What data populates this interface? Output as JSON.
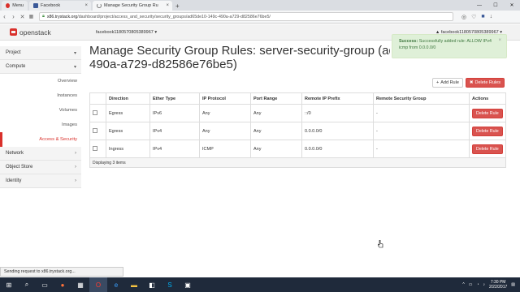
{
  "browser": {
    "tabs": [
      {
        "label": "Menu",
        "icon": "opera-icon",
        "active": false
      },
      {
        "label": "Facebook",
        "icon": "facebook-icon",
        "active": false
      },
      {
        "label": "Manage Security Group Ru",
        "icon": "loading-icon",
        "active": true
      }
    ],
    "new_tab": "+",
    "url_host": "x86.trystack.org",
    "url_path": "/dashboard/project/access_and_security/security_groups/ad65de10-149c-490a-a729-d82586e76be5/"
  },
  "topnav": {
    "brand": "openstack",
    "project": "facebook1180570805389967 ▾",
    "user": "▲ facebook1180570805389967 ▾"
  },
  "sidebar": {
    "items": [
      {
        "label": "Project",
        "chev": "▾"
      },
      {
        "label": "Compute",
        "chev": "▾"
      },
      {
        "label": "Network",
        "chev": "›"
      },
      {
        "label": "Object Store",
        "chev": "›"
      },
      {
        "label": "Identity",
        "chev": "›"
      }
    ],
    "compute_subitems": [
      "Overview",
      "Instances",
      "Volumes",
      "Images",
      "Access & Security"
    ],
    "active_subitem": "Access & Security"
  },
  "main": {
    "title_line1": "Manage Security Group Rules: server-security-group (ad65de10-149c-",
    "title_line2": "490a-a729-d82586e76be5)",
    "add_rule": "Add Rule",
    "delete_rules": "Delete Rules",
    "columns": [
      "",
      "Direction",
      "Ether Type",
      "IP Protocol",
      "Port Range",
      "Remote IP Prefix",
      "Remote Security Group",
      "Actions"
    ],
    "rows": [
      {
        "direction": "Egress",
        "ether": "IPv6",
        "protocol": "Any",
        "port": "Any",
        "prefix": "::/0",
        "group": "-",
        "action": "Delete Rule"
      },
      {
        "direction": "Egress",
        "ether": "IPv4",
        "protocol": "Any",
        "port": "Any",
        "prefix": "0.0.0.0/0",
        "group": "-",
        "action": "Delete Rule"
      },
      {
        "direction": "Ingress",
        "ether": "IPv4",
        "protocol": "ICMP",
        "port": "Any",
        "prefix": "0.0.0.0/0",
        "group": "-",
        "action": "Delete Rule"
      }
    ],
    "footer": "Displaying 3 items"
  },
  "alert": {
    "title": "Success:",
    "message": "Successfully added rule: ALLOW IPv4 icmp from 0.0.0.0/0",
    "close": "×"
  },
  "status_text": "Sending request to x86.trystack.org...",
  "taskbar": {
    "time": "7:30 PM",
    "date": "2/22/2017"
  },
  "colors": {
    "accent_red": "#d9302b",
    "danger": "#d9534f",
    "success_bg": "#dff0d8",
    "taskbar": "#1f2a3b"
  }
}
